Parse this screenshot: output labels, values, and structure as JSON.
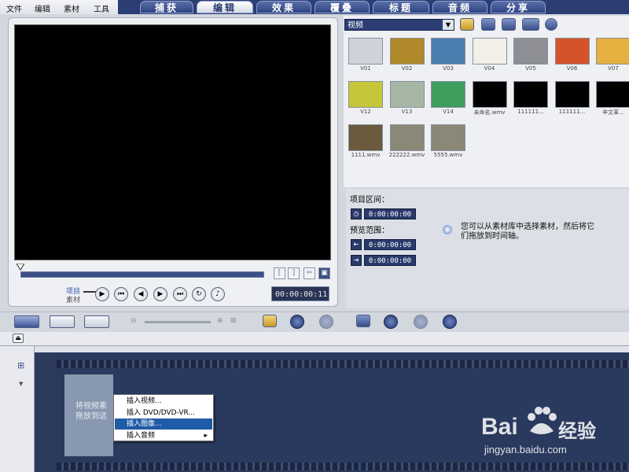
{
  "menu": [
    "文件",
    "编辑",
    "素材",
    "工具"
  ],
  "tabs": [
    "捕获",
    "编辑",
    "效果",
    "覆叠",
    "标题",
    "音频",
    "分享"
  ],
  "active_tab": "编辑",
  "player": {
    "mode_project": "项目",
    "mode_clip": "素材",
    "timecode": "00:00:00:11"
  },
  "library": {
    "category": "视频",
    "thumbnails": [
      {
        "label": "V01",
        "color": "#cfd3d9"
      },
      {
        "label": "V02",
        "color": "#b08a2a"
      },
      {
        "label": "V03",
        "color": "#4a7fb0"
      },
      {
        "label": "V04",
        "color": "#f2efe7"
      },
      {
        "label": "V05",
        "color": "#8d8f94"
      },
      {
        "label": "V06",
        "color": "#d4532b"
      },
      {
        "label": "V07",
        "color": "#e6b040"
      },
      {
        "label": "V12",
        "color": "#c6c63a"
      },
      {
        "label": "V13",
        "color": "#a7b7a6"
      },
      {
        "label": "V14",
        "color": "#3e9e5d"
      },
      {
        "label": "未命名.wmv",
        "color": "#000000"
      },
      {
        "label": "111111...",
        "color": "#000000"
      },
      {
        "label": "111111...",
        "color": "#000000"
      },
      {
        "label": "辛文革...",
        "color": "#000000"
      },
      {
        "label": "1111.wmv",
        "color": "#6b5a3e"
      },
      {
        "label": "222222.wmv",
        "color": "#8a8877"
      },
      {
        "label": "5555.wmv",
        "color": "#8a8877"
      }
    ]
  },
  "info": {
    "project_duration_label": "项目区间：",
    "project_duration": "0:00:00:00",
    "preview_range_label": "预览范围：",
    "preview_start": "0:00:00:00",
    "preview_end": "0:00:00:00",
    "hint": "您可以从素材库中选择素材，然后将它们拖放到时间轴。"
  },
  "timeline": {
    "dropzone_text_1": "将视频素",
    "dropzone_text_2": "拖放到这"
  },
  "context_menu": [
    {
      "label": "插入视频...",
      "selected": false,
      "submenu": false
    },
    {
      "label": "插入 DVD/DVD-VR...",
      "selected": false,
      "submenu": false
    },
    {
      "label": "插入图像...",
      "selected": true,
      "submenu": false
    },
    {
      "label": "插入音频",
      "selected": false,
      "submenu": true
    }
  ],
  "watermark": {
    "brand": "Bai",
    "brand_cn": "经验",
    "url": "jingyan.baidu.com"
  }
}
